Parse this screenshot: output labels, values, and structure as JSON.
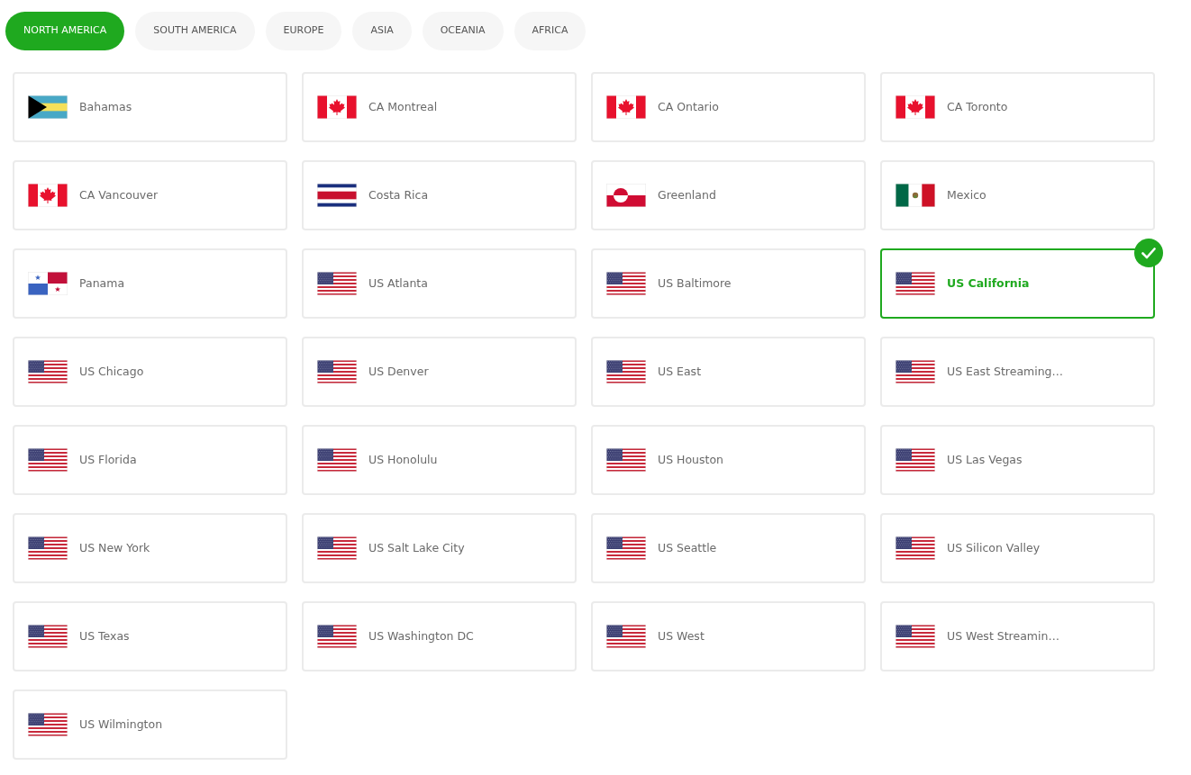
{
  "region_tabs": [
    {
      "label": "NORTH AMERICA",
      "selected": true
    },
    {
      "label": "SOUTH AMERICA",
      "selected": false
    },
    {
      "label": "EUROPE",
      "selected": false
    },
    {
      "label": "ASIA",
      "selected": false
    },
    {
      "label": "OCEANIA",
      "selected": false
    },
    {
      "label": "AFRICA",
      "selected": false
    }
  ],
  "locations": [
    {
      "name": "Bahamas",
      "kind": "bahamas",
      "selected": false
    },
    {
      "name": "CA Montreal",
      "kind": "canada",
      "selected": false
    },
    {
      "name": "CA Ontario",
      "kind": "canada",
      "selected": false
    },
    {
      "name": "CA Toronto",
      "kind": "canada",
      "selected": false
    },
    {
      "name": "CA Vancouver",
      "kind": "canada",
      "selected": false
    },
    {
      "name": "Costa Rica",
      "kind": "costarica",
      "selected": false
    },
    {
      "name": "Greenland",
      "kind": "greenland",
      "selected": false
    },
    {
      "name": "Mexico",
      "kind": "mexico",
      "selected": false
    },
    {
      "name": "Panama",
      "kind": "panama",
      "selected": false
    },
    {
      "name": "US Atlanta",
      "kind": "usa",
      "selected": false
    },
    {
      "name": "US Baltimore",
      "kind": "usa",
      "selected": false
    },
    {
      "name": "US California",
      "kind": "usa",
      "selected": true
    },
    {
      "name": "US Chicago",
      "kind": "usa",
      "selected": false
    },
    {
      "name": "US Denver",
      "kind": "usa",
      "selected": false
    },
    {
      "name": "US East",
      "kind": "usa",
      "selected": false
    },
    {
      "name": "US East Streaming…",
      "kind": "usa",
      "selected": false
    },
    {
      "name": "US Florida",
      "kind": "usa",
      "selected": false
    },
    {
      "name": "US Honolulu",
      "kind": "usa",
      "selected": false
    },
    {
      "name": "US Houston",
      "kind": "usa",
      "selected": false
    },
    {
      "name": "US Las Vegas",
      "kind": "usa",
      "selected": false
    },
    {
      "name": "US New York",
      "kind": "usa",
      "selected": false
    },
    {
      "name": "US Salt Lake City",
      "kind": "usa",
      "selected": false
    },
    {
      "name": "US Seattle",
      "kind": "usa",
      "selected": false
    },
    {
      "name": "US Silicon Valley",
      "kind": "usa",
      "selected": false
    },
    {
      "name": "US Texas",
      "kind": "usa",
      "selected": false
    },
    {
      "name": "US Washington DC",
      "kind": "usa",
      "selected": false
    },
    {
      "name": "US West",
      "kind": "usa",
      "selected": false
    },
    {
      "name": "US West Streamin…",
      "kind": "usa",
      "selected": false
    },
    {
      "name": "US Wilmington",
      "kind": "usa",
      "selected": false
    }
  ]
}
